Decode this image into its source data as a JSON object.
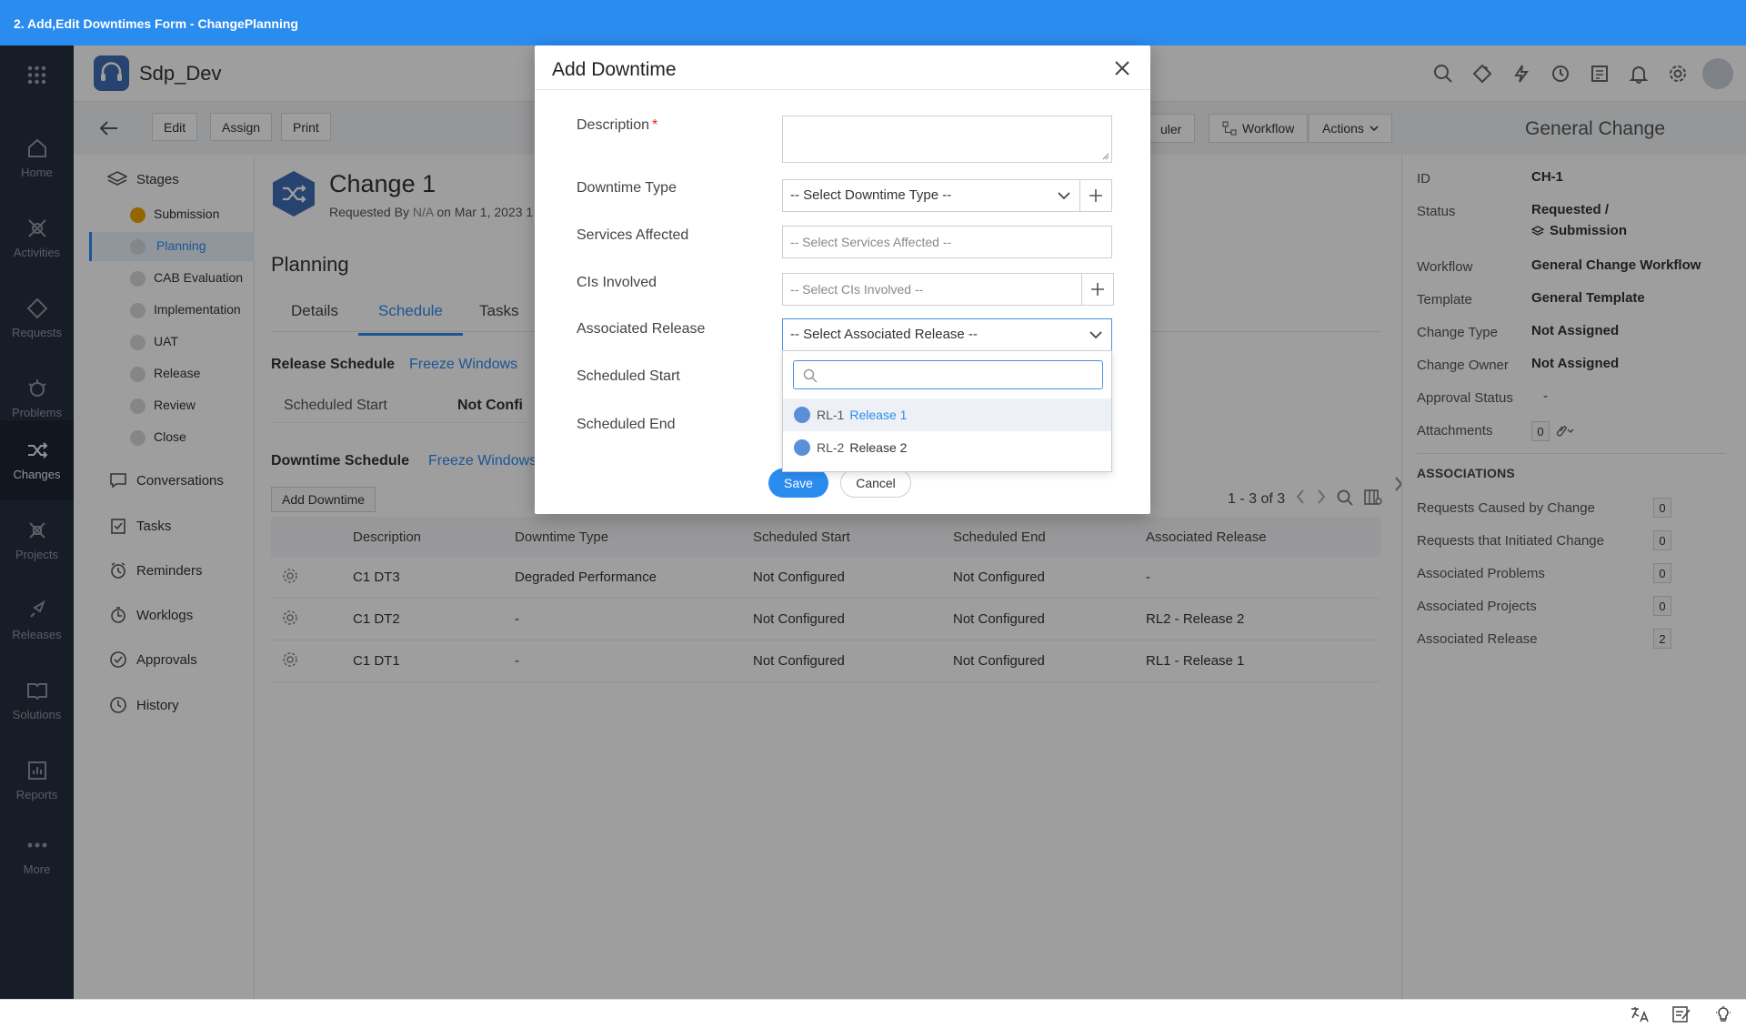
{
  "window": {
    "title": "2. Add,Edit Downtimes Form - ChangePlanning"
  },
  "app": {
    "name": "Sdp_Dev"
  },
  "leftnav": {
    "items": [
      {
        "label": "Home",
        "icon": "home-icon"
      },
      {
        "label": "Activities",
        "icon": "activities-icon"
      },
      {
        "label": "Requests",
        "icon": "requests-icon"
      },
      {
        "label": "Problems",
        "icon": "problems-icon"
      },
      {
        "label": "Changes",
        "icon": "changes-icon",
        "active": true
      },
      {
        "label": "Projects",
        "icon": "projects-icon"
      },
      {
        "label": "Releases",
        "icon": "releases-icon"
      },
      {
        "label": "Solutions",
        "icon": "solutions-icon"
      },
      {
        "label": "Reports",
        "icon": "reports-icon"
      },
      {
        "label": "More",
        "icon": "more-icon"
      }
    ]
  },
  "toolbar": {
    "edit": "Edit",
    "assign": "Assign",
    "print": "Print",
    "scheduler_partial": "uler",
    "workflow": "Workflow",
    "actions": "Actions",
    "template_title": "General Change"
  },
  "stages": {
    "heading": "Stages",
    "items": [
      "Submission",
      "Planning",
      "CAB Evaluation",
      "Implementation",
      "UAT",
      "Release",
      "Review",
      "Close"
    ]
  },
  "side_links": [
    "Conversations",
    "Tasks",
    "Reminders",
    "Worklogs",
    "Approvals",
    "History"
  ],
  "change": {
    "title": "Change 1",
    "requested_by_label": "Requested By",
    "requested_by": "N/A",
    "on_label": "on",
    "date": "Mar 1, 2023 1"
  },
  "main": {
    "section_title": "Planning",
    "tabs": [
      "Details",
      "Schedule",
      "Tasks"
    ],
    "release_schedule": {
      "title": "Release Schedule",
      "link": "Freeze Windows",
      "field": "Scheduled Start",
      "value": "Not Confi"
    },
    "downtime_schedule": {
      "title": "Downtime Schedule",
      "link": "Freeze Windows",
      "add_button": "Add Downtime",
      "pager": "1 - 3 of 3"
    },
    "table": {
      "columns": [
        "Description",
        "Downtime Type",
        "Scheduled Start",
        "Scheduled End",
        "Associated Release"
      ],
      "rows": [
        [
          "C1 DT3",
          "Degraded Performance",
          "Not Configured",
          "Not Configured",
          "-"
        ],
        [
          "C1 DT2",
          "-",
          "Not Configured",
          "Not Configured",
          "RL2 - Release 2"
        ],
        [
          "C1 DT1",
          "-",
          "Not Configured",
          "Not Configured",
          "RL1 - Release 1"
        ]
      ]
    }
  },
  "details": {
    "fields": [
      {
        "label": "ID",
        "value": "CH-1"
      },
      {
        "label": "Status",
        "value": "Requested /",
        "value2": "Submission"
      },
      {
        "label": "Workflow",
        "value": "General Change Workflow"
      },
      {
        "label": "Template",
        "value": "General Template"
      },
      {
        "label": "Change Type",
        "value": "Not Assigned"
      },
      {
        "label": "Change Owner",
        "value": "Not Assigned"
      },
      {
        "label": "Approval Status",
        "value": "-"
      },
      {
        "label": "Attachments",
        "value": "0"
      }
    ],
    "associations_heading": "ASSOCIATIONS",
    "associations": [
      {
        "label": "Requests Caused by Change",
        "count": "0"
      },
      {
        "label": "Requests that Initiated Change",
        "count": "0"
      },
      {
        "label": "Associated Problems",
        "count": "0"
      },
      {
        "label": "Associated Projects",
        "count": "0"
      },
      {
        "label": "Associated Release",
        "count": "2"
      }
    ]
  },
  "modal": {
    "title": "Add Downtime",
    "fields": {
      "description": "Description",
      "downtime_type": "Downtime Type",
      "downtime_type_value": "-- Select Downtime Type --",
      "services_affected": "Services Affected",
      "services_placeholder": "-- Select Services Affected --",
      "cis_involved": "CIs Involved",
      "cis_placeholder": "-- Select CIs Involved --",
      "associated_release": "Associated Release",
      "associated_release_value": "-- Select Associated Release --",
      "scheduled_start": "Scheduled Start",
      "scheduled_end": "Scheduled End"
    },
    "dropdown_options": [
      {
        "code": "RL-1",
        "name": "Release 1"
      },
      {
        "code": "RL-2",
        "name": "Release 2"
      }
    ],
    "save": "Save",
    "cancel": "Cancel"
  },
  "colors": {
    "accent": "#2b8cf0",
    "nav_bg": "#24303e",
    "stage_done": "#f0a500",
    "required": "#e0261c"
  }
}
